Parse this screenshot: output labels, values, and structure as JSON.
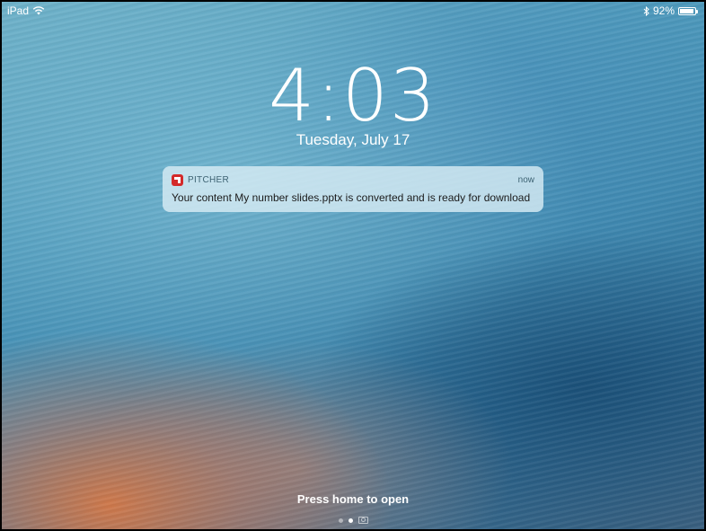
{
  "status_bar": {
    "device": "iPad",
    "battery_percent": "92%",
    "battery_level": 0.92,
    "icons": [
      "wifi-icon",
      "bluetooth-icon",
      "battery-icon"
    ]
  },
  "lock_screen": {
    "time": "4:03",
    "date": "Tuesday, July 17",
    "hint": "Press home to open"
  },
  "notification": {
    "app_name": "PITCHER",
    "time": "now",
    "message": "Your content My number slides.pptx is converted and is ready for download",
    "icon_color": "#d32a2a"
  },
  "page_indicator": {
    "count": 2,
    "active_index": 1,
    "trailing_icon": "camera-icon"
  }
}
